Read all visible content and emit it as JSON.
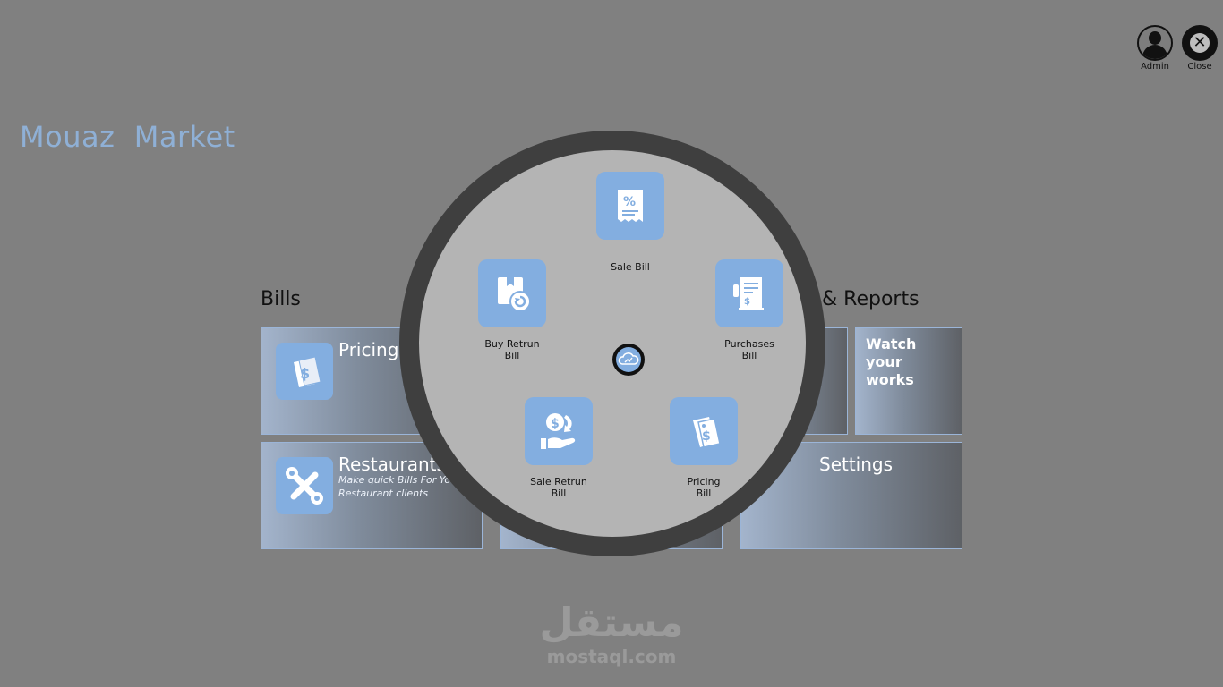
{
  "app": {
    "title": "Mouaz  Market"
  },
  "topbar": {
    "admin_label": "Admin",
    "close_label": "Close"
  },
  "sections": {
    "bills": "Bills",
    "reports": "& Reports"
  },
  "tiles": {
    "pricing": {
      "label": "Pricing"
    },
    "restaurant": {
      "label": "Restaurants",
      "subtitle": "Make quick Bills For Your Restaurant clients"
    },
    "watch": {
      "label": "Watch your works"
    },
    "settings": {
      "label": "Settings"
    }
  },
  "dial": {
    "items": [
      {
        "label": "Sale Bill",
        "icon": "receipt-percent-icon"
      },
      {
        "label": "Buy Retrun\nBill",
        "icon": "box-return-icon"
      },
      {
        "label": "Purchases\nBill",
        "icon": "purchase-document-icon"
      },
      {
        "label": "Sale Retrun\nBill",
        "icon": "hand-money-return-icon"
      },
      {
        "label": "Pricing\nBill",
        "icon": "price-tag-icon"
      }
    ],
    "center_icon": "cloud-chart-icon"
  },
  "watermark": {
    "arabic": "مستقل",
    "latin": "mostaql.com"
  },
  "colors": {
    "background": "#808080",
    "accent": "#83aee0",
    "title": "#8fb0d6",
    "dial_ring": "#3f3f3f",
    "dial_face": "#b4b4b4"
  }
}
